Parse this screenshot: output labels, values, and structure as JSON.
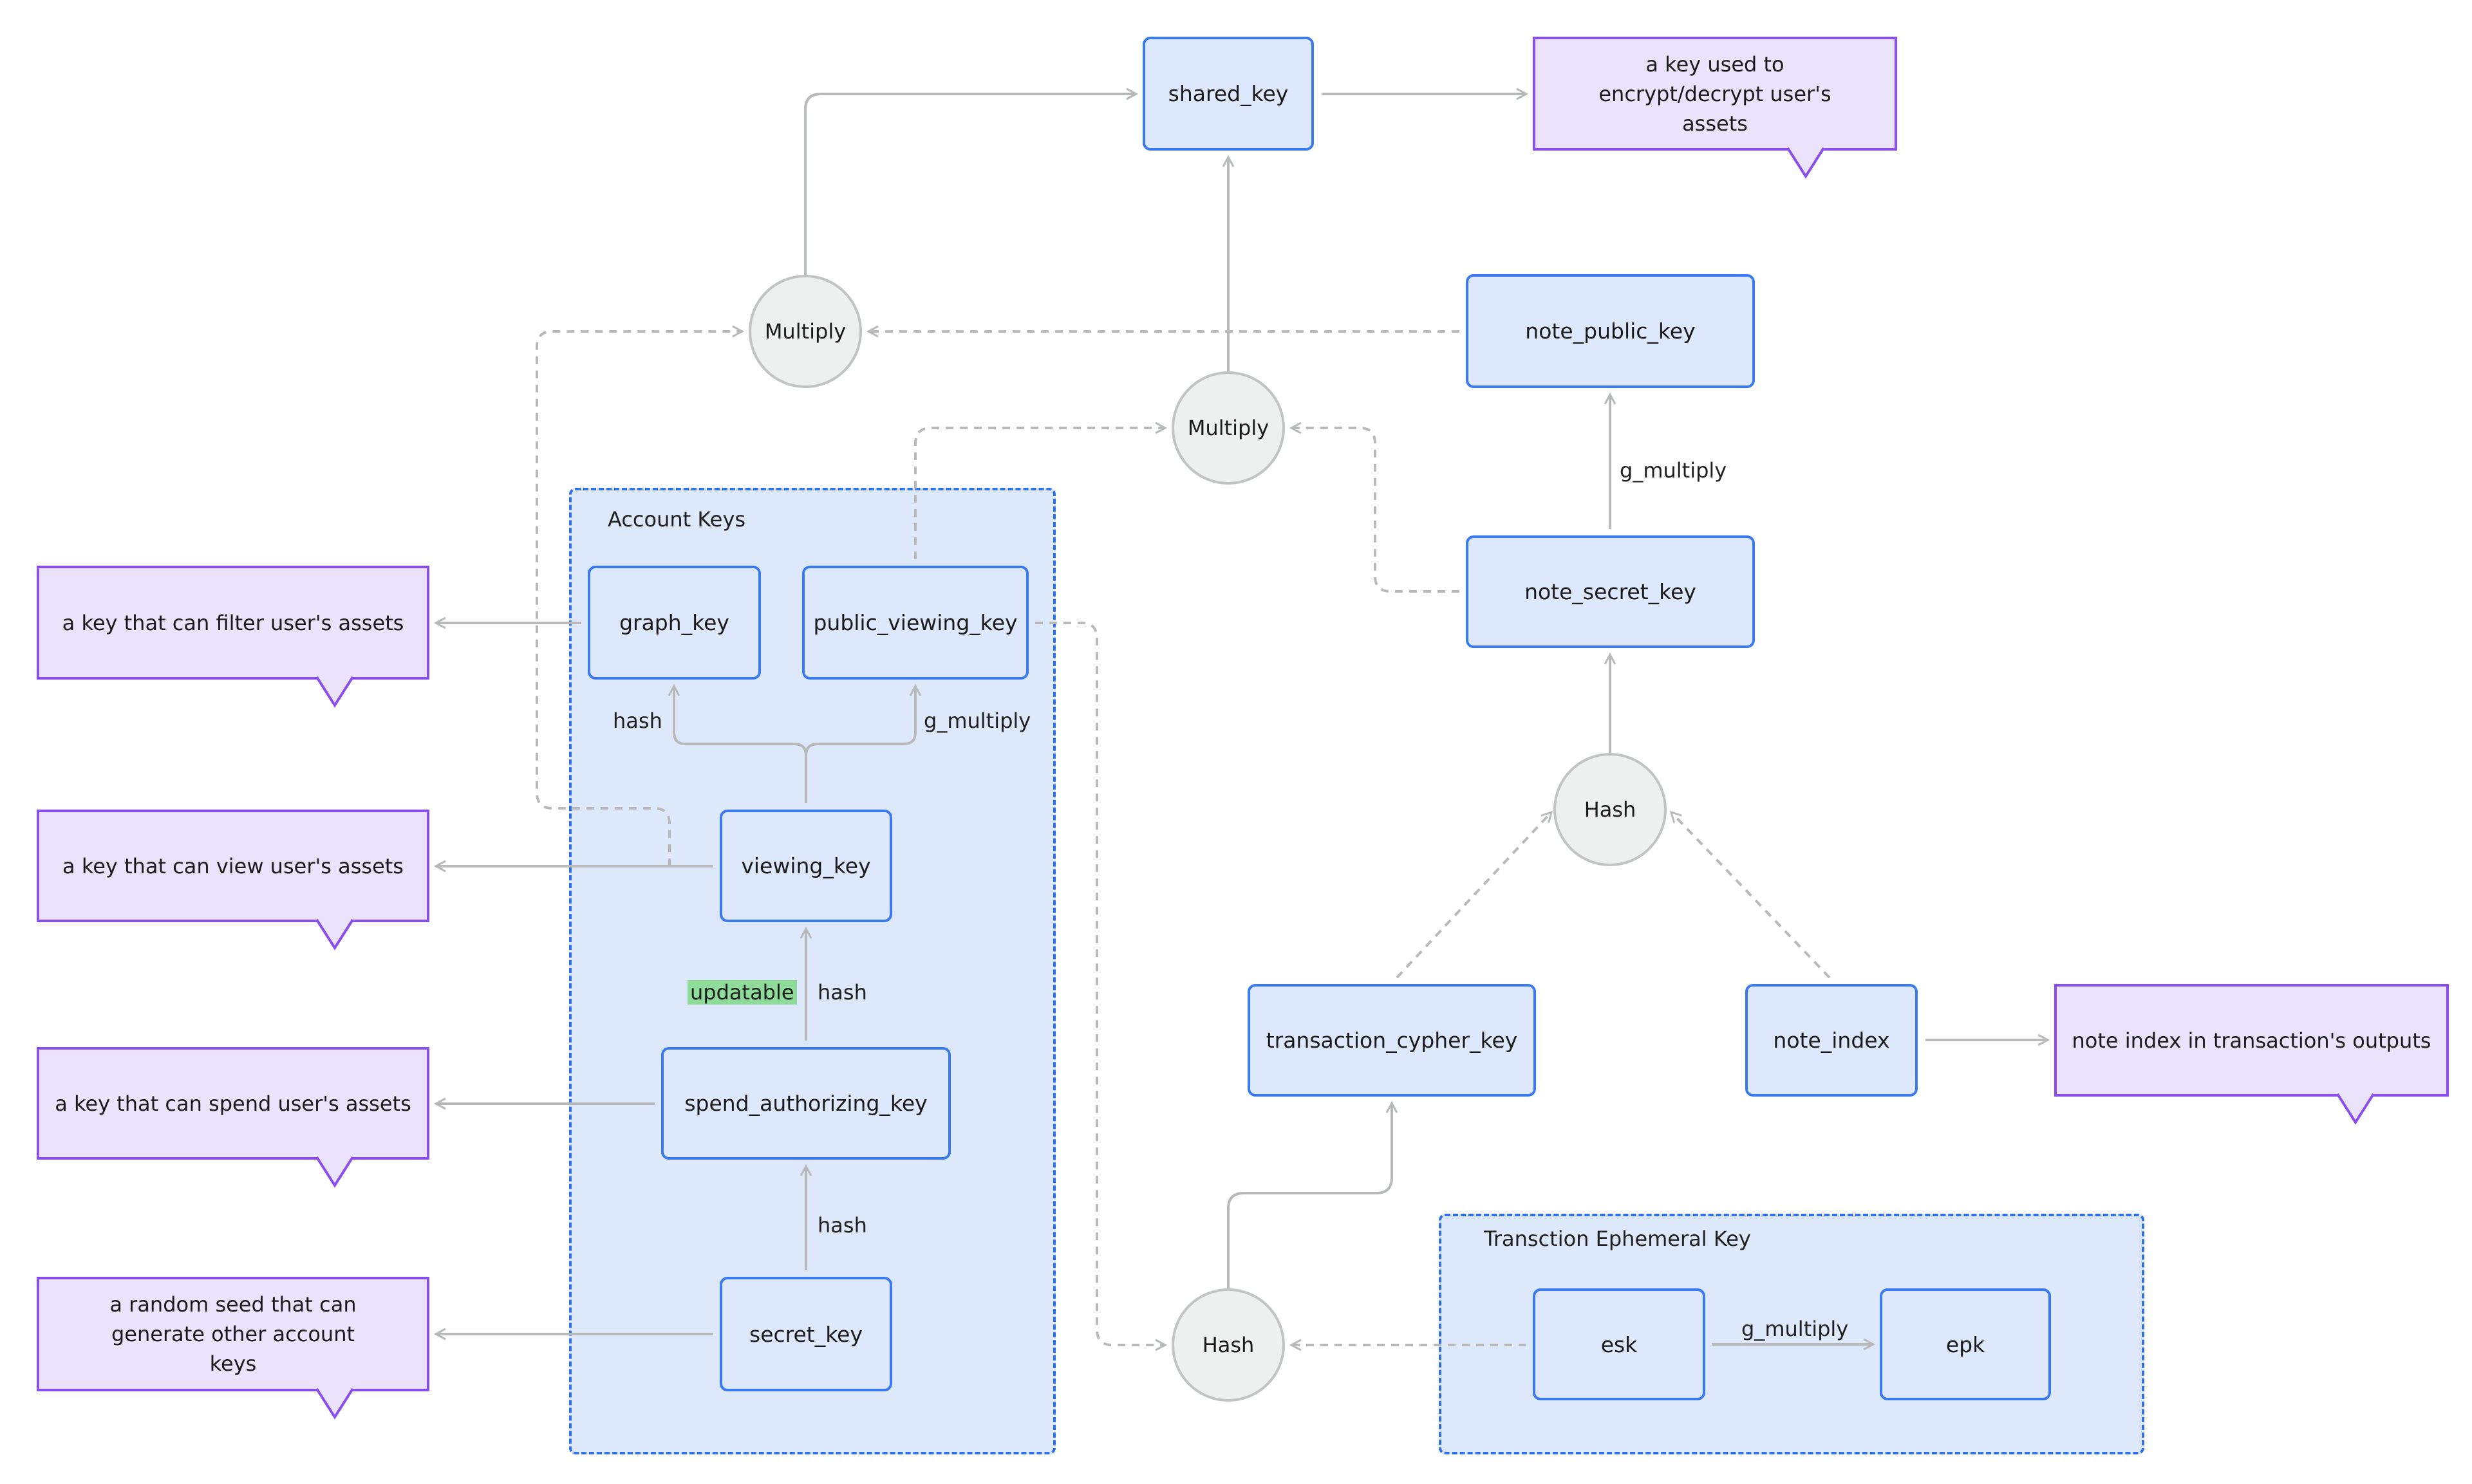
{
  "groups": {
    "account_keys": {
      "title": "Account Keys"
    },
    "ephemeral": {
      "title": "Transction Ephemeral Key"
    }
  },
  "nodes": {
    "shared_key": "shared_key",
    "note_public_key": "note_public_key",
    "note_secret_key": "note_secret_key",
    "transaction_cypher_key": "transaction_cypher_key",
    "note_index": "note_index",
    "graph_key": "graph_key",
    "public_viewing_key": "public_viewing_key",
    "viewing_key": "viewing_key",
    "spend_authorizing_key": "spend_authorizing_key",
    "secret_key": "secret_key",
    "esk": "esk",
    "epk": "epk"
  },
  "operations": {
    "multiply_top": "Multiply",
    "multiply_mid": "Multiply",
    "hash_note": "Hash",
    "hash_tx": "Hash"
  },
  "annotations": {
    "shared_key": "a key used to encrypt/decrypt user's assets",
    "graph_key": "a key that can filter user's assets",
    "viewing_key": "a key that can view user's assets",
    "spend_authorizing_key": "a key that can spend user's assets",
    "secret_key": "a random seed that can generate other account keys",
    "note_index": "note index in transaction's outputs"
  },
  "edge_labels": {
    "note_secret_to_public": "g_multiply",
    "viewing_to_graph": "hash",
    "viewing_to_public_viewing": "g_multiply",
    "spend_to_viewing": "hash",
    "spend_to_viewing_badge": "updatable",
    "secret_to_spend": "hash",
    "esk_to_epk": "g_multiply"
  },
  "colors": {
    "node_fill": "#dde8fc",
    "node_border": "#3a7af0",
    "group_fill": "#dee8fb",
    "note_fill": "#ebe2fb",
    "note_border": "#8a4ef0",
    "op_fill": "#eeefef",
    "edge": "#b8baba",
    "badge": "#8fdc9a"
  }
}
